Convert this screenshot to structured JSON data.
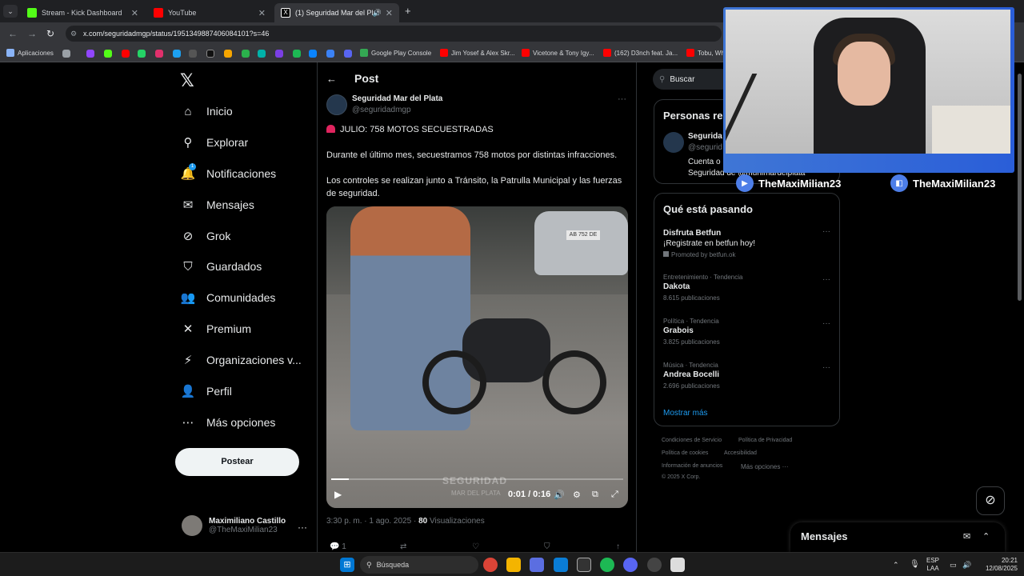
{
  "browser": {
    "tabs": [
      {
        "label": "Stream - Kick Dashboard",
        "color": "#53fc18"
      },
      {
        "label": "YouTube",
        "color": "#ff0000"
      },
      {
        "label": "(1) Seguridad Mar del Plata",
        "color": "#ffffff"
      }
    ],
    "url": "x.com/seguridadmgp/status/1951349887406084101?s=46",
    "bookmarks": [
      {
        "label": "Aplicaciones"
      },
      {
        "label": "Google Play Console"
      },
      {
        "label": "Jim Yosef & Alex Skr..."
      },
      {
        "label": "Vicetone & Tony Igy..."
      },
      {
        "label": "(162) D3nch feat. Ja..."
      },
      {
        "label": "Tobu, Wh"
      }
    ]
  },
  "sidebar": {
    "items": [
      {
        "label": "Inicio",
        "icon": "home-icon",
        "glyph": "⌂"
      },
      {
        "label": "Explorar",
        "icon": "search-icon",
        "glyph": "⚲"
      },
      {
        "label": "Notificaciones",
        "icon": "bell-icon",
        "glyph": "🔔"
      },
      {
        "label": "Mensajes",
        "icon": "envelope-icon",
        "glyph": "✉"
      },
      {
        "label": "Grok",
        "icon": "grok-icon",
        "glyph": "⊘"
      },
      {
        "label": "Guardados",
        "icon": "bookmark-icon",
        "glyph": "⛉"
      },
      {
        "label": "Comunidades",
        "icon": "people-icon",
        "glyph": "👥"
      },
      {
        "label": "Premium",
        "icon": "x-icon",
        "glyph": "✕"
      },
      {
        "label": "Organizaciones v...",
        "icon": "lightning-icon",
        "glyph": "⚡"
      },
      {
        "label": "Perfil",
        "icon": "person-icon",
        "glyph": "👤"
      },
      {
        "label": "Más opciones",
        "icon": "more-circle-icon",
        "glyph": "⋯"
      }
    ],
    "notification_count": "1",
    "post_button": "Postear",
    "account": {
      "name": "Maximiliano Castillo",
      "handle": "@TheMaxiMilian23"
    }
  },
  "post": {
    "header_title": "Post",
    "author_name": "Seguridad Mar del Plata",
    "author_handle": "@seguridadmgp",
    "line1": "JULIO: 758 MOTOS SECUESTRADAS",
    "line2": "Durante el último mes, secuestramos 758 motos por distintas infracciones.",
    "line3": "Los controles se realizan junto a Tránsito, la Patrulla Municipal y las fuerzas de seguridad.",
    "video": {
      "watermark": "SEGURIDAD",
      "watermark_sub": "MAR DEL PLATA",
      "plate": "AB 752 DE",
      "time": "0:01 / 0:16",
      "progress": 0.06
    },
    "timestamp": "3:30 p. m. · 1 ago. 2025 · ",
    "views_count": "80",
    "views_label": " Visualizaciones",
    "reply_count": "1"
  },
  "right": {
    "search_placeholder": "Buscar",
    "related_title": "Personas re",
    "related_name": "Segurida",
    "related_handle": "@segurid",
    "related_bio1": "Cuenta o",
    "related_bio2": "Seguridad de @munimardelplata",
    "trends_title": "Qué está pasando",
    "trends": [
      {
        "cat": "",
        "name": "Disfruta Betfun",
        "sub": "¡Registrate en betfun hoy!",
        "count": "Promoted by betfun.ok"
      },
      {
        "cat": "Entretenimiento · Tendencia",
        "name": "Dakota",
        "sub": "",
        "count": "8.615 publicaciones"
      },
      {
        "cat": "Política · Tendencia",
        "name": "Grabois",
        "sub": "",
        "count": "3.825 publicaciones"
      },
      {
        "cat": "Música · Tendencia",
        "name": "Andrea Bocelli",
        "sub": "",
        "count": "2.696 publicaciones"
      }
    ],
    "show_more": "Mostrar más",
    "footer": [
      "Condiciones de Servicio",
      "Política de Privacidad",
      "Política de cookies",
      "Accesibilidad",
      "Información de anuncios",
      "Más opciones ···",
      "© 2025 X Corp."
    ]
  },
  "messages": {
    "title": "Mensajes"
  },
  "overlay": {
    "youtube_channel": "TheMaxiMilian23",
    "twitch_channel": "TheMaxiMilian23",
    "accent": "#3f76d6"
  },
  "taskbar": {
    "search_label": "Búsqueda",
    "lang": "ESP",
    "lang2": "LAA",
    "time": "20:21",
    "date": "12/08/2025"
  }
}
